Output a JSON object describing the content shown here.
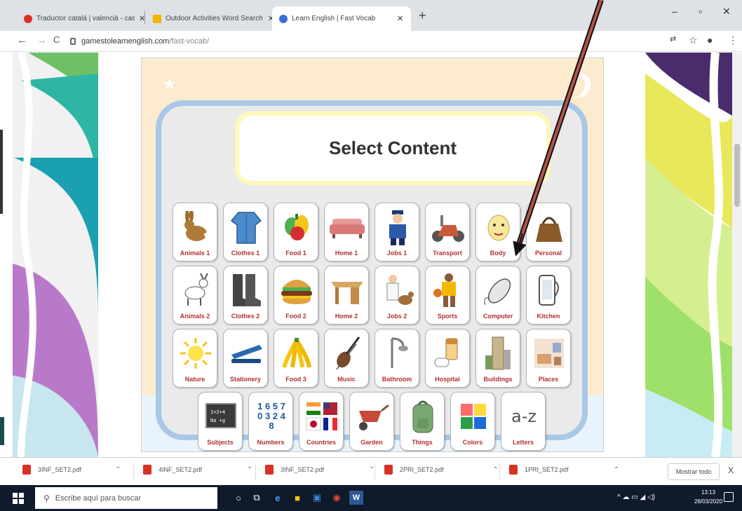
{
  "browser": {
    "tabs": [
      {
        "title": "Traductor catalá | valencià - cas",
        "favicon_color": "#d93025",
        "active": false
      },
      {
        "title": "Outdoor Activities Word Search",
        "favicon_color": "#f2b400",
        "active": false
      },
      {
        "title": "Learn English | Fast Vocab",
        "favicon_color": "#3a6fd8",
        "active": true
      }
    ],
    "new_tab": "+",
    "url_host": "gamestolearnenglish.com",
    "url_path": "/fast-vocab/",
    "win": {
      "minimize": "–",
      "maximize": "▫",
      "close": "✕"
    },
    "nav": {
      "back": "←",
      "forward": "→",
      "reload": "C"
    }
  },
  "game": {
    "title": "Select Content",
    "categories": [
      [
        "Animals 1",
        "Clothes 1",
        "Food 1",
        "Home 1",
        "Jobs 1",
        "Transport",
        "Body",
        "Personal"
      ],
      [
        "Animals 2",
        "Clothes 2",
        "Food 2",
        "Home 2",
        "Jobs 2",
        "Sports",
        "Computer",
        "Kitchen"
      ],
      [
        "Nature",
        "Stationery",
        "Food 3",
        "Music",
        "Bathroom",
        "Hospital",
        "Buildings",
        "Places"
      ],
      [
        "Subjects",
        "Numbers",
        "Countries",
        "Garden",
        "Things",
        "Colors",
        "Letters"
      ]
    ],
    "numbers_icon": "1 6 5 7 0 3 2 4 8",
    "letters_icon": "a-z"
  },
  "downloads": {
    "files": [
      "3INF_SET2.pdf",
      "4INF_SET2.pdf",
      "3INF_SET2.pdf",
      "2PRI_SET2.pdf",
      "1PRI_SET2.pdf"
    ],
    "show_all": "Mostrar todo",
    "close": "X"
  },
  "taskbar": {
    "search_placeholder": "Escribe aquí para buscar",
    "time": "13:13",
    "date": "28/03/2020"
  }
}
